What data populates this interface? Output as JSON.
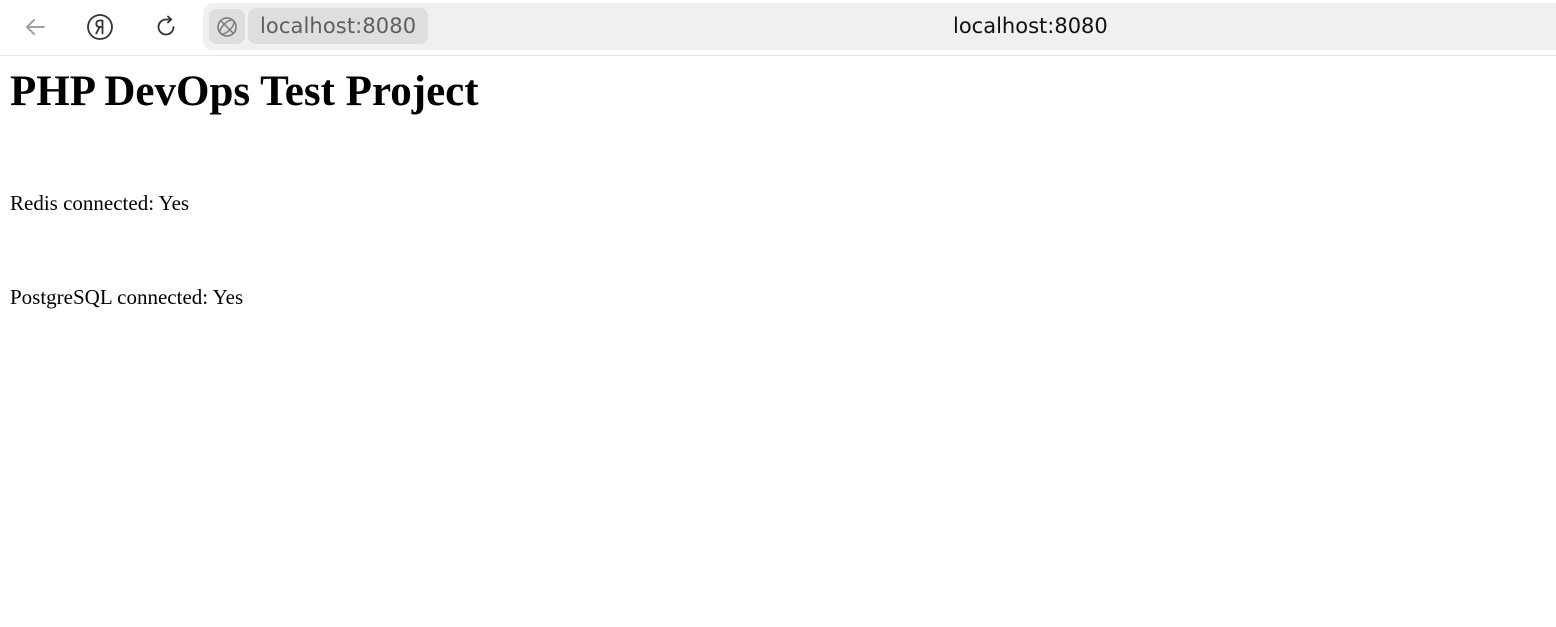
{
  "browser": {
    "address_chip": "localhost:8080",
    "address_center": "localhost:8080",
    "icons": {
      "back": "back-arrow-icon",
      "home": "yandex-icon",
      "reload": "reload-icon",
      "site": "globe-icon"
    }
  },
  "page": {
    "heading": "PHP DevOps Test Project",
    "redis_status": "Redis connected: Yes",
    "postgres_status": "PostgreSQL connected: Yes"
  }
}
